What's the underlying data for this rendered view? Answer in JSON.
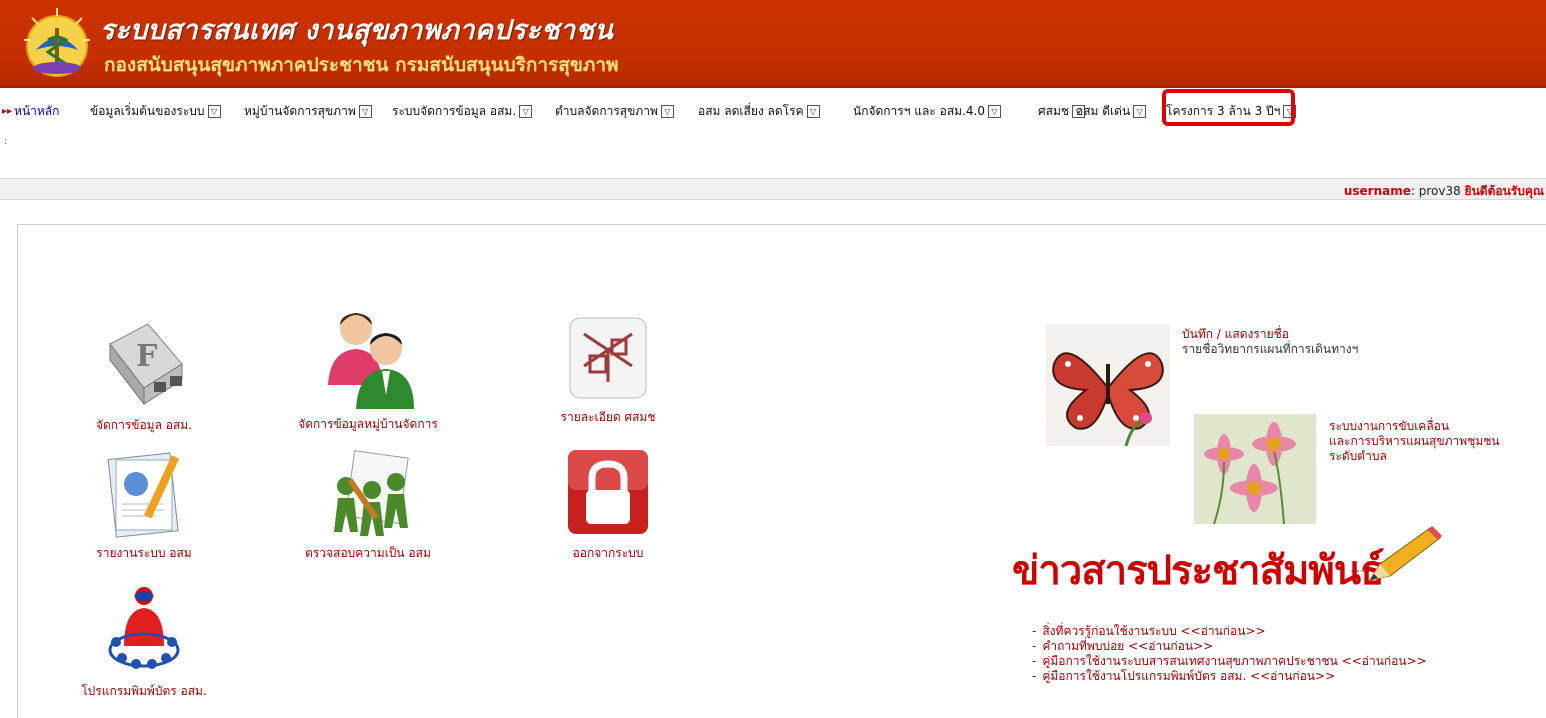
{
  "header": {
    "title": "ระบบสารสนเทศ งานสุขภาพภาคประชาชน",
    "subtitle": "กองสนับสนุนสุขภาพภาคประชาชน กรมสนับสนุนบริการสุขภาพ"
  },
  "nav": {
    "items": [
      {
        "label": "หน้าหลัก"
      },
      {
        "label": "ข้อมูลเริ่มต้นของระบบ"
      },
      {
        "label": "หมู่บ้านจัดการสุขภาพ"
      },
      {
        "label": "ระบบจัดการข้อมูล อสม."
      },
      {
        "label": "ตำบลจัดการสุขภาพ"
      },
      {
        "label": "อสม ลดเสี่ยง ลดโรค"
      },
      {
        "label": "นักจัดการฯ และ อสม.4.0"
      },
      {
        "label": "ศสมช"
      },
      {
        "label": "อสม ดีเด่น"
      },
      {
        "label": "โครงการ 3 ล้าน 3 ปีฯ"
      }
    ]
  },
  "welcome": {
    "username_label": "username",
    "username_value": ": prov38",
    "message": "ยินดีต้อนรับคุณ"
  },
  "tiles": [
    {
      "label": "จัดการข้อมูล อสม.",
      "icon": "database-icon"
    },
    {
      "label": "จัดการข้อมูลหมู่บ้านจัดการ",
      "icon": "users-icon"
    },
    {
      "label": "รายละเอียด ศสมช",
      "icon": "structure-icon"
    },
    {
      "label": "รายงานระบบ อสม",
      "icon": "report-icon"
    },
    {
      "label": "ตรวจสอบความเป็น อสม",
      "icon": "check-people-icon"
    },
    {
      "label": "ออกจากระบบ",
      "icon": "lock-icon"
    },
    {
      "label": "โปรแกรมพิมพ์บัตร อสม.",
      "icon": "card-print-icon"
    }
  ],
  "side_links": [
    {
      "lines": [
        "บันทึก / แสดงรายชื่อ",
        "รายชื่อวิทยากรแผนที่การเดินทางฯ"
      ],
      "icon": "butterfly-icon"
    },
    {
      "lines": [
        "ระบบงานการขับเคลื่อน",
        "และการบริหารแผนสุขภาพชุมชน",
        "ระดับตำบล"
      ],
      "icon": "flowers-icon"
    }
  ],
  "news": {
    "title": "ข่าวสารประชาสัมพันธ์",
    "items": [
      "สิ่งที่ควรรู้ก่อนใช้งานระบบ <<อ่านก่อน>>",
      "คำถามที่พบบ่อย <<อ่านก่อน>>",
      "คู่มือการใช้งานระบบสารสนเทศงานสุขภาพภาคประชาชน <<อ่านก่อน>>",
      "คู่มือการใช้งานโปรแกรมพิมพ์บัตร อสม. <<อ่านก่อน>>"
    ]
  }
}
